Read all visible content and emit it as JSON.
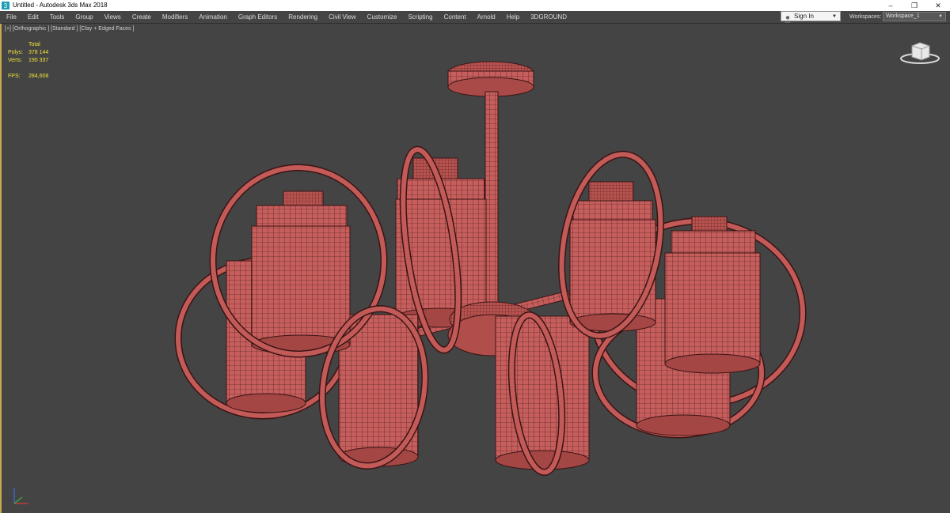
{
  "window": {
    "title": "Untitled - Autodesk 3ds Max 2018",
    "controls": {
      "minimize": "–",
      "maximize": "❐",
      "close": "✕"
    }
  },
  "menu": {
    "items": [
      "File",
      "Edit",
      "Tools",
      "Group",
      "Views",
      "Create",
      "Modifiers",
      "Animation",
      "Graph Editors",
      "Rendering",
      "Civil View",
      "Customize",
      "Scripting",
      "Content",
      "Arnold",
      "Help",
      "3DGROUND"
    ]
  },
  "account": {
    "signin_label": "Sign In"
  },
  "workspace": {
    "label": "Workspaces:",
    "value": "Workspace_1"
  },
  "viewport": {
    "label": "[+] [Orthographic ] [Standard ] [Clay + Edged Faces ]",
    "stats": {
      "header": "Total",
      "polys_label": "Polys:",
      "polys_value": "378 144",
      "verts_label": "Verts:",
      "verts_value": "190 337",
      "fps_label": "FPS:",
      "fps_value": "284,608"
    }
  },
  "colors": {
    "viewport_bg": "#444444",
    "model_fill": "#c25a58",
    "wire": "#3a1414",
    "stats_text": "#f0e33a",
    "active_border": "#c9a94e"
  },
  "icons": [
    "app-icon",
    "user-icon",
    "dropdown-arrow-icon",
    "viewcube-icon",
    "axis-gizmo-icon"
  ]
}
